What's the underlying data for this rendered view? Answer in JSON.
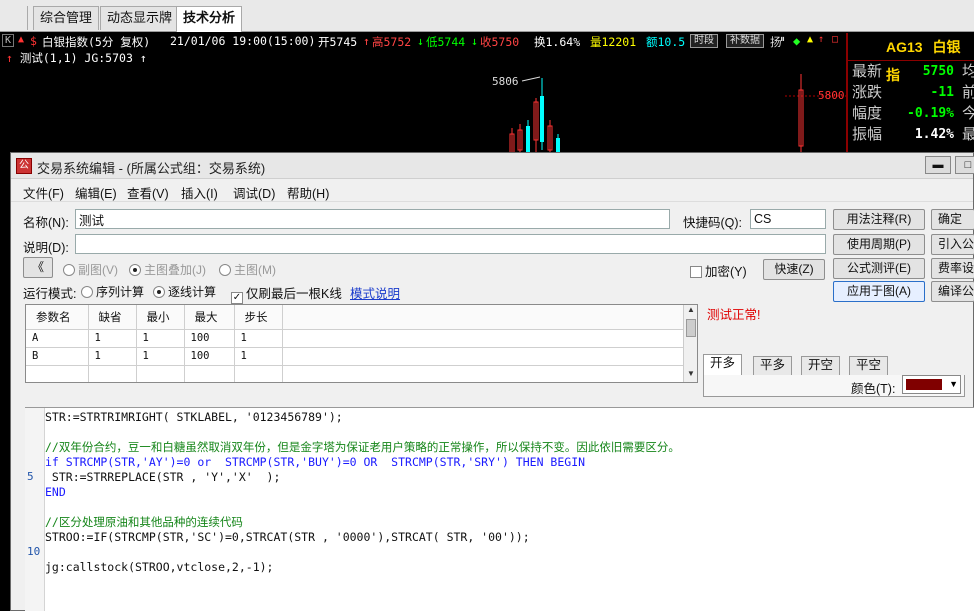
{
  "tabs": [
    "综合管理",
    "动态显示牌",
    "技术分析"
  ],
  "quote": {
    "symbol_name": "白银指数(5分 复权)",
    "datetime": "21/01/06 19:00(15:00)",
    "open": "开5745",
    "high": "高5752",
    "low": "低5744",
    "close": "收5750",
    "change": "换1.64%",
    "volume": "量12201",
    "amount": "额10.5",
    "btn_fenshi": "时段",
    "btn_buzhu": "补数据"
  },
  "indicator_line": "测试(1,1) JG:5703",
  "chart_labels": {
    "peak": "5806",
    "price_axis": "5800"
  },
  "right_panel": {
    "code": "AG13",
    "name": "白银指",
    "rows": [
      {
        "label": "最新",
        "value": "5750",
        "color": "#00ff00",
        "extra": "均"
      },
      {
        "label": "涨跌",
        "value": "-11",
        "color": "#00ff00",
        "extra": "前"
      },
      {
        "label": "幅度",
        "value": "-0.19%",
        "color": "#00ff00",
        "extra": "今"
      },
      {
        "label": "振幅",
        "value": "1.42%",
        "color": "#ffffff",
        "extra": "最"
      }
    ]
  },
  "dialog": {
    "title": "交易系统编辑 - (所属公式组：交易系统)",
    "menu": [
      "文件(F)",
      "编辑(E)",
      "查看(V)",
      "插入(I)",
      "调试(D)",
      "帮助(H)"
    ],
    "name_label": "名称(N):",
    "name_value": "测试",
    "shortcut_label": "快捷码(Q):",
    "shortcut_value": "CS",
    "desc_label": "说明(D):",
    "desc_value": "",
    "collapse_btn": "《",
    "radio_sub": "副图(V)",
    "radio_main_overlay": "主图叠加(J)",
    "radio_main": "主图(M)",
    "encrypt": "加密(Y)",
    "quick_btn": "快速(Z)",
    "run_mode_label": "运行模式:",
    "run_seq": "序列计算",
    "run_bar": "逐线计算",
    "only_last_bar": "仅刷最后一根K线",
    "mode_link": "模式说明",
    "buttons": {
      "syntax": "用法注释(R)",
      "period": "使用周期(P)",
      "test": "公式测评(E)",
      "apply": "应用于图(A)",
      "ok": "确定",
      "import": "引入公",
      "fee": "费率设",
      "compile": "编译公"
    },
    "param_headers": [
      "参数名",
      "缺省",
      "最小",
      "最大",
      "步长"
    ],
    "params": [
      [
        "A",
        "1",
        "1",
        "100",
        "1"
      ],
      [
        "B",
        "1",
        "1",
        "100",
        "1"
      ]
    ],
    "status_message": "测试正常!",
    "trade_tabs": [
      "开多",
      "平多",
      "开空",
      "平空"
    ],
    "color_label": "颜色(T):",
    "code_lines": [
      {
        "ln": "",
        "text": "STR:=STRTRIMRIGHT( STKLABEL, '0123456789');",
        "cls": ""
      },
      {
        "ln": "",
        "text": "",
        "cls": ""
      },
      {
        "ln": "",
        "text": "//双年份合约，豆一和白糖虽然取消双年份，但是金字塔为保证老用户策略的正常操作，所以保持不变。因此依旧需要区分。",
        "cls": "c-green"
      },
      {
        "ln": "",
        "text": "if STRCMP(STR,'AY')=0 or  STRCMP(STR,'BUY')=0 OR  STRCMP(STR,'SRY') THEN BEGIN",
        "cls": "c-blue"
      },
      {
        "ln": "5",
        "text": " STR:=STRREPLACE(STR , 'Y','X'  );",
        "cls": ""
      },
      {
        "ln": "",
        "text": "END",
        "cls": "c-blue"
      },
      {
        "ln": "",
        "text": "",
        "cls": ""
      },
      {
        "ln": "",
        "text": "//区分处理原油和其他品种的连续代码",
        "cls": "c-green"
      },
      {
        "ln": "",
        "text": "STROO:=IF(STRCMP(STR,'SC')=0,STRCAT(STR , '0000'),STRCAT( STR, '00'));",
        "cls": ""
      },
      {
        "ln": "10",
        "text": "",
        "cls": ""
      },
      {
        "ln": "",
        "text": "jg:callstock(STROO,vtclose,2,-1);",
        "cls": ""
      }
    ]
  }
}
